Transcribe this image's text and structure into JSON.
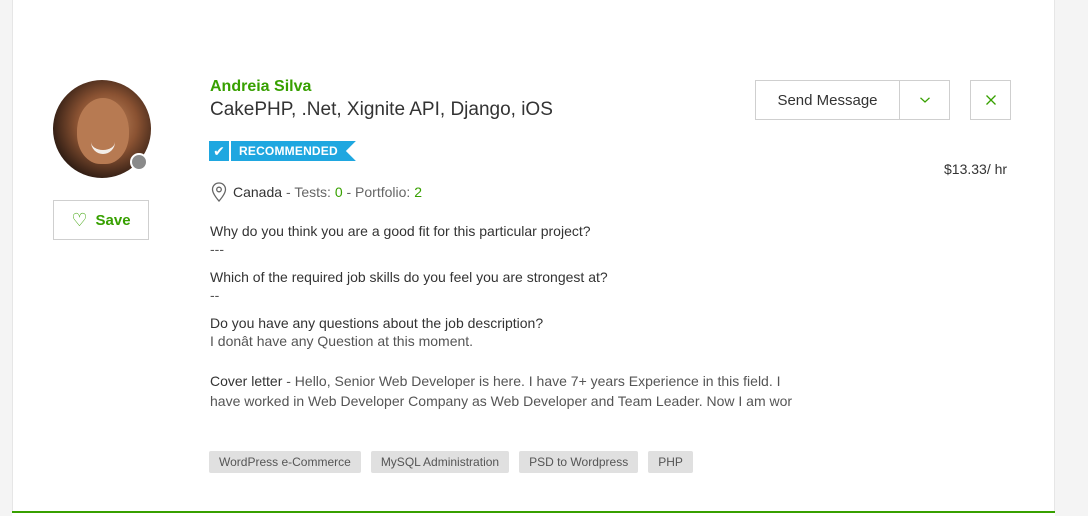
{
  "freelancer": {
    "name": "Andreia Silva",
    "title": "CakePHP, .Net, Xignite API, Django, iOS",
    "badge": "RECOMMENDED",
    "country": "Canada",
    "tests_label": "- Tests:",
    "tests_value": "0",
    "portfolio_label": "- Portfolio:",
    "portfolio_value": "2",
    "rate": "$13.33/ hr",
    "status": "offline"
  },
  "buttons": {
    "save": "Save",
    "send_message": "Send Message"
  },
  "qa": [
    {
      "q": "Why do you think you are a good fit for this particular project?",
      "a": "---"
    },
    {
      "q": "Which of the required job skills do you feel you are strongest at?",
      "a": "--"
    },
    {
      "q": "Do you have any questions about the job description?",
      "a": "I donât have any Question at this moment."
    }
  ],
  "cover_letter": {
    "label": "Cover letter",
    "text": " - Hello, Senior Web Developer is here. I have 7+ years Experience in this field. I have worked in Web Developer Company as Web Developer and Team Leader. Now I am wor"
  },
  "skills": [
    "WordPress e-Commerce",
    "MySQL Administration",
    "PSD to Wordpress",
    "PHP"
  ],
  "colors": {
    "brand_green": "#37a000",
    "badge_blue": "#1fa7e0",
    "skill_bg": "#e0e0e0"
  },
  "icons": {
    "save": "heart-outline-icon",
    "location": "map-pin-icon",
    "dropdown": "chevron-down-icon",
    "close": "close-icon",
    "badge": "checkmark-icon"
  }
}
